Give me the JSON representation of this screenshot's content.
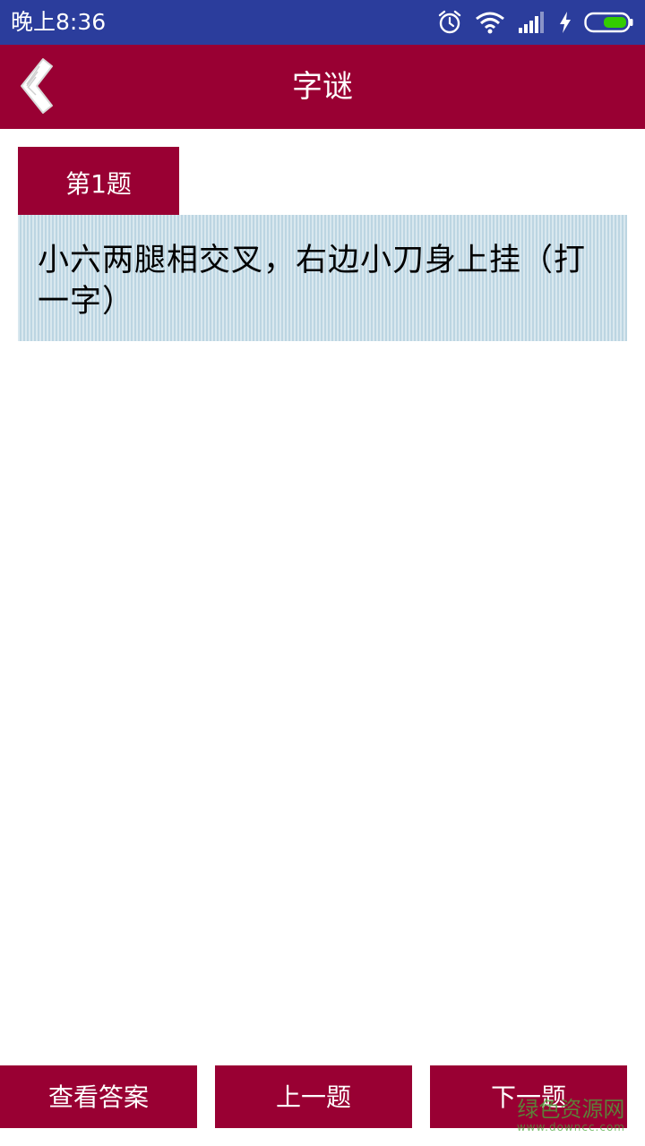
{
  "status_bar": {
    "time": "晚上8:36",
    "icons": [
      "alarm-icon",
      "wifi-icon",
      "signal-icon",
      "charging-icon",
      "battery-icon"
    ],
    "battery_color": "#33cc00"
  },
  "app_bar": {
    "title": "字谜",
    "back_icon": "chevron-left-icon",
    "color": "#990033"
  },
  "question": {
    "tab_label": "第1题",
    "text": "小六两腿相交叉，右边小刀身上挂（打一字）"
  },
  "buttons": {
    "answer": "查看答案",
    "prev": "上一题",
    "next": "下一题"
  },
  "watermark": {
    "main": "绿色资源网",
    "sub": "www.downcc.com"
  }
}
